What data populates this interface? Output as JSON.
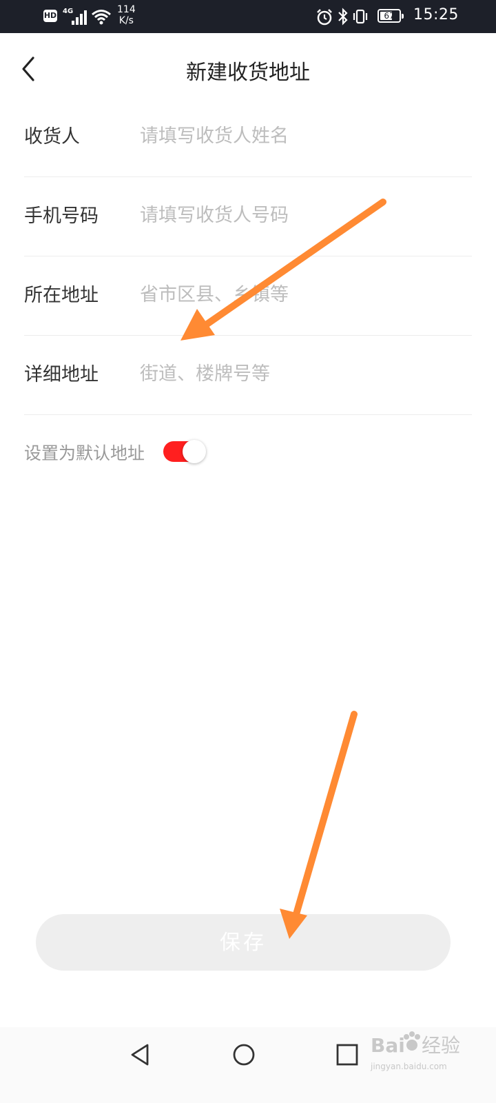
{
  "status_bar": {
    "hd": "HD",
    "network": "4G",
    "speed_value": "114",
    "speed_unit": "K/s",
    "battery_level": "67",
    "time": "15:25",
    "icons": [
      "hd-icon",
      "signal-icon",
      "wifi-icon",
      "alarm-icon",
      "bluetooth-icon",
      "vibrate-icon",
      "battery-icon"
    ]
  },
  "header": {
    "title": "新建收货地址",
    "back_icon": "chevron-left-icon"
  },
  "form": {
    "fields": [
      {
        "label": "收货人",
        "placeholder": "请填写收货人姓名",
        "value": ""
      },
      {
        "label": "手机号码",
        "placeholder": "请填写收货人号码",
        "value": ""
      },
      {
        "label": "所在地址",
        "placeholder": "省市区县、乡镇等",
        "value": ""
      },
      {
        "label": "详细地址",
        "placeholder": "街道、楼牌号等",
        "value": ""
      }
    ],
    "default_address_label": "设置为默认地址",
    "default_address_on": true
  },
  "save_label": "保存",
  "colors": {
    "status_bar_bg": "#1d2029",
    "toggle_on": "#ff1f1f",
    "save_bg": "#eeeeee",
    "annotation_arrow": "#ff8a33"
  },
  "nav_bar": {
    "icons": [
      "back-triangle-icon",
      "home-circle-icon",
      "recent-square-icon"
    ]
  },
  "watermark": {
    "text": "jingyan.baidu.com",
    "logo": "Bai经验"
  }
}
